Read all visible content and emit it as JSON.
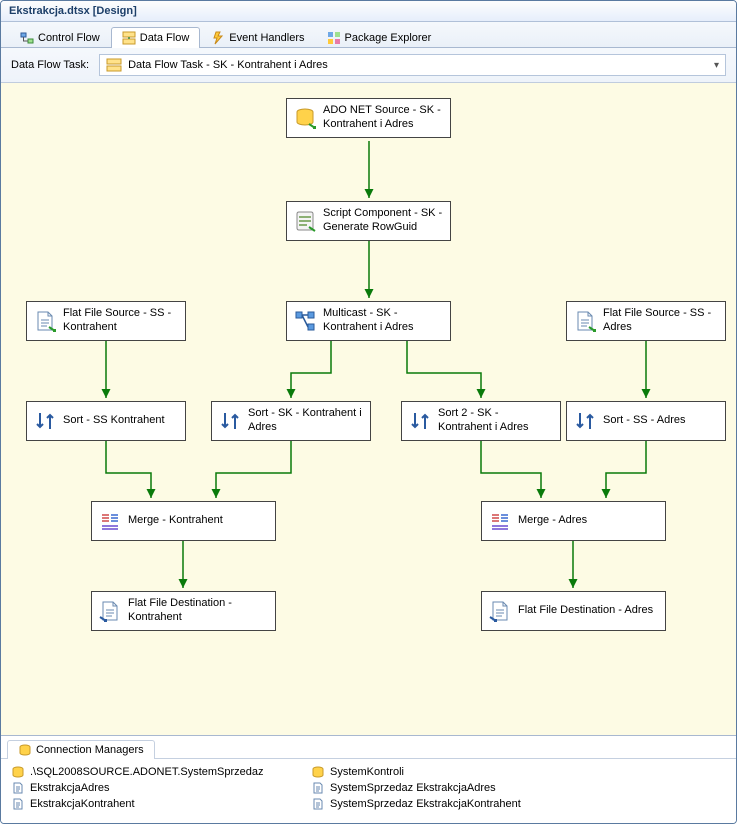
{
  "title": "Ekstrakcja.dtsx [Design]",
  "tabs": {
    "control_flow": "Control Flow",
    "data_flow": "Data Flow",
    "event_handlers": "Event Handlers",
    "package_explorer": "Package Explorer"
  },
  "task_label": "Data Flow Task:",
  "task_selected": "Data Flow Task - SK - Kontrahent i Adres",
  "nodes": {
    "ado_source": "ADO NET Source - SK - Kontrahent i Adres",
    "script": "Script Component - SK - Generate RowGuid",
    "multicast": "Multicast - SK - Kontrahent i Adres",
    "ff_source_kontr": "Flat File Source - SS - Kontrahent",
    "ff_source_adres": "Flat File Source - SS - Adres",
    "sort_ss_kontr": "Sort - SS Kontrahent",
    "sort_sk_kontr": "Sort - SK - Kontrahent i Adres",
    "sort2_sk": "Sort 2 - SK - Kontrahent i Adres",
    "sort_ss_adres": "Sort - SS - Adres",
    "merge_kontr": "Merge - Kontrahent",
    "merge_adres": "Merge - Adres",
    "ff_dest_kontr": "Flat File Destination - Kontrahent",
    "ff_dest_adres": "Flat File Destination - Adres"
  },
  "bottom_tab": "Connection Managers",
  "connections": {
    "c1": ".\\SQL2008SOURCE.ADONET.SystemSprzedaz",
    "c2": "EkstrakcjaAdres",
    "c3": "EkstrakcjaKontrahent",
    "c4": "SystemKontroli",
    "c5": "SystemSprzedaz EkstrakcjaAdres",
    "c6": "SystemSprzedaz EkstrakcjaKontrahent"
  }
}
